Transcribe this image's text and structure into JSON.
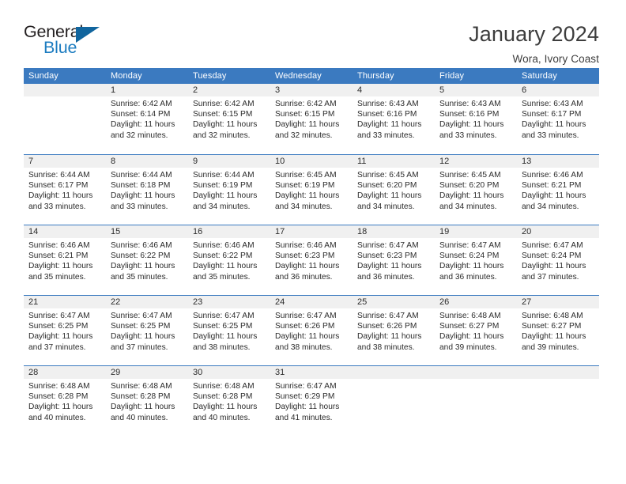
{
  "logo": {
    "word1": "General",
    "word2": "Blue",
    "triangle_color": "#11659e",
    "blue_color": "#1c7cc0"
  },
  "header": {
    "title": "January 2024",
    "subtitle": "Wora, Ivory Coast"
  },
  "theme": {
    "header_blue": "#3b7ac0",
    "day_band_gray": "#f0f0f0",
    "text_color": "#2b2b2b"
  },
  "weekdays": [
    "Sunday",
    "Monday",
    "Tuesday",
    "Wednesday",
    "Thursday",
    "Friday",
    "Saturday"
  ],
  "weeks": [
    [
      {
        "day": "",
        "blank": true
      },
      {
        "day": "1",
        "sunrise": "Sunrise: 6:42 AM",
        "sunset": "Sunset: 6:14 PM",
        "daylight1": "Daylight: 11 hours",
        "daylight2": "and 32 minutes."
      },
      {
        "day": "2",
        "sunrise": "Sunrise: 6:42 AM",
        "sunset": "Sunset: 6:15 PM",
        "daylight1": "Daylight: 11 hours",
        "daylight2": "and 32 minutes."
      },
      {
        "day": "3",
        "sunrise": "Sunrise: 6:42 AM",
        "sunset": "Sunset: 6:15 PM",
        "daylight1": "Daylight: 11 hours",
        "daylight2": "and 32 minutes."
      },
      {
        "day": "4",
        "sunrise": "Sunrise: 6:43 AM",
        "sunset": "Sunset: 6:16 PM",
        "daylight1": "Daylight: 11 hours",
        "daylight2": "and 33 minutes."
      },
      {
        "day": "5",
        "sunrise": "Sunrise: 6:43 AM",
        "sunset": "Sunset: 6:16 PM",
        "daylight1": "Daylight: 11 hours",
        "daylight2": "and 33 minutes."
      },
      {
        "day": "6",
        "sunrise": "Sunrise: 6:43 AM",
        "sunset": "Sunset: 6:17 PM",
        "daylight1": "Daylight: 11 hours",
        "daylight2": "and 33 minutes."
      }
    ],
    [
      {
        "day": "7",
        "sunrise": "Sunrise: 6:44 AM",
        "sunset": "Sunset: 6:17 PM",
        "daylight1": "Daylight: 11 hours",
        "daylight2": "and 33 minutes."
      },
      {
        "day": "8",
        "sunrise": "Sunrise: 6:44 AM",
        "sunset": "Sunset: 6:18 PM",
        "daylight1": "Daylight: 11 hours",
        "daylight2": "and 33 minutes."
      },
      {
        "day": "9",
        "sunrise": "Sunrise: 6:44 AM",
        "sunset": "Sunset: 6:19 PM",
        "daylight1": "Daylight: 11 hours",
        "daylight2": "and 34 minutes."
      },
      {
        "day": "10",
        "sunrise": "Sunrise: 6:45 AM",
        "sunset": "Sunset: 6:19 PM",
        "daylight1": "Daylight: 11 hours",
        "daylight2": "and 34 minutes."
      },
      {
        "day": "11",
        "sunrise": "Sunrise: 6:45 AM",
        "sunset": "Sunset: 6:20 PM",
        "daylight1": "Daylight: 11 hours",
        "daylight2": "and 34 minutes."
      },
      {
        "day": "12",
        "sunrise": "Sunrise: 6:45 AM",
        "sunset": "Sunset: 6:20 PM",
        "daylight1": "Daylight: 11 hours",
        "daylight2": "and 34 minutes."
      },
      {
        "day": "13",
        "sunrise": "Sunrise: 6:46 AM",
        "sunset": "Sunset: 6:21 PM",
        "daylight1": "Daylight: 11 hours",
        "daylight2": "and 34 minutes."
      }
    ],
    [
      {
        "day": "14",
        "sunrise": "Sunrise: 6:46 AM",
        "sunset": "Sunset: 6:21 PM",
        "daylight1": "Daylight: 11 hours",
        "daylight2": "and 35 minutes."
      },
      {
        "day": "15",
        "sunrise": "Sunrise: 6:46 AM",
        "sunset": "Sunset: 6:22 PM",
        "daylight1": "Daylight: 11 hours",
        "daylight2": "and 35 minutes."
      },
      {
        "day": "16",
        "sunrise": "Sunrise: 6:46 AM",
        "sunset": "Sunset: 6:22 PM",
        "daylight1": "Daylight: 11 hours",
        "daylight2": "and 35 minutes."
      },
      {
        "day": "17",
        "sunrise": "Sunrise: 6:46 AM",
        "sunset": "Sunset: 6:23 PM",
        "daylight1": "Daylight: 11 hours",
        "daylight2": "and 36 minutes."
      },
      {
        "day": "18",
        "sunrise": "Sunrise: 6:47 AM",
        "sunset": "Sunset: 6:23 PM",
        "daylight1": "Daylight: 11 hours",
        "daylight2": "and 36 minutes."
      },
      {
        "day": "19",
        "sunrise": "Sunrise: 6:47 AM",
        "sunset": "Sunset: 6:24 PM",
        "daylight1": "Daylight: 11 hours",
        "daylight2": "and 36 minutes."
      },
      {
        "day": "20",
        "sunrise": "Sunrise: 6:47 AM",
        "sunset": "Sunset: 6:24 PM",
        "daylight1": "Daylight: 11 hours",
        "daylight2": "and 37 minutes."
      }
    ],
    [
      {
        "day": "21",
        "sunrise": "Sunrise: 6:47 AM",
        "sunset": "Sunset: 6:25 PM",
        "daylight1": "Daylight: 11 hours",
        "daylight2": "and 37 minutes."
      },
      {
        "day": "22",
        "sunrise": "Sunrise: 6:47 AM",
        "sunset": "Sunset: 6:25 PM",
        "daylight1": "Daylight: 11 hours",
        "daylight2": "and 37 minutes."
      },
      {
        "day": "23",
        "sunrise": "Sunrise: 6:47 AM",
        "sunset": "Sunset: 6:25 PM",
        "daylight1": "Daylight: 11 hours",
        "daylight2": "and 38 minutes."
      },
      {
        "day": "24",
        "sunrise": "Sunrise: 6:47 AM",
        "sunset": "Sunset: 6:26 PM",
        "daylight1": "Daylight: 11 hours",
        "daylight2": "and 38 minutes."
      },
      {
        "day": "25",
        "sunrise": "Sunrise: 6:47 AM",
        "sunset": "Sunset: 6:26 PM",
        "daylight1": "Daylight: 11 hours",
        "daylight2": "and 38 minutes."
      },
      {
        "day": "26",
        "sunrise": "Sunrise: 6:48 AM",
        "sunset": "Sunset: 6:27 PM",
        "daylight1": "Daylight: 11 hours",
        "daylight2": "and 39 minutes."
      },
      {
        "day": "27",
        "sunrise": "Sunrise: 6:48 AM",
        "sunset": "Sunset: 6:27 PM",
        "daylight1": "Daylight: 11 hours",
        "daylight2": "and 39 minutes."
      }
    ],
    [
      {
        "day": "28",
        "sunrise": "Sunrise: 6:48 AM",
        "sunset": "Sunset: 6:28 PM",
        "daylight1": "Daylight: 11 hours",
        "daylight2": "and 40 minutes."
      },
      {
        "day": "29",
        "sunrise": "Sunrise: 6:48 AM",
        "sunset": "Sunset: 6:28 PM",
        "daylight1": "Daylight: 11 hours",
        "daylight2": "and 40 minutes."
      },
      {
        "day": "30",
        "sunrise": "Sunrise: 6:48 AM",
        "sunset": "Sunset: 6:28 PM",
        "daylight1": "Daylight: 11 hours",
        "daylight2": "and 40 minutes."
      },
      {
        "day": "31",
        "sunrise": "Sunrise: 6:47 AM",
        "sunset": "Sunset: 6:29 PM",
        "daylight1": "Daylight: 11 hours",
        "daylight2": "and 41 minutes."
      },
      {
        "day": "",
        "blank": true
      },
      {
        "day": "",
        "blank": true
      },
      {
        "day": "",
        "blank": true
      }
    ]
  ]
}
